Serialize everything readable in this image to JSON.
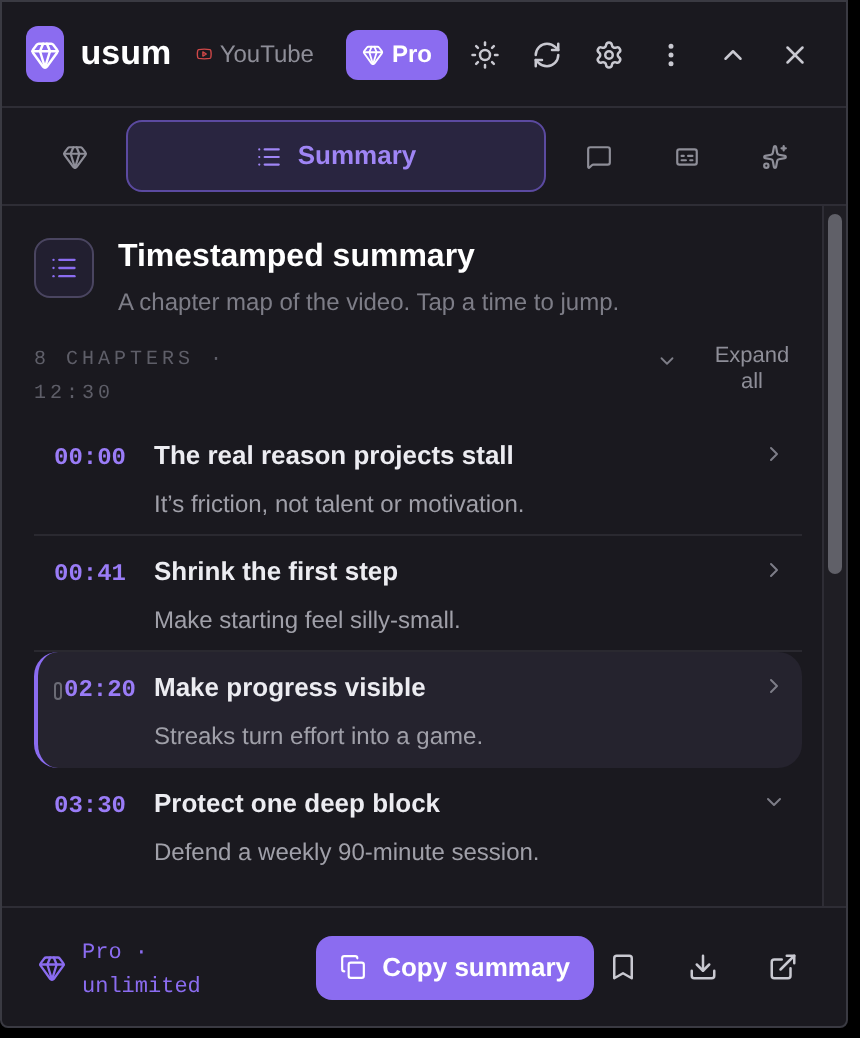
{
  "header": {
    "app_name": "usum",
    "source": "YouTube",
    "plan_button": "Pro"
  },
  "tabs": [
    {
      "kind": "icon",
      "selected": false
    },
    {
      "kind": "label",
      "label": "Summary",
      "selected": true
    },
    {
      "kind": "icon",
      "selected": false
    },
    {
      "kind": "icon",
      "selected": false
    },
    {
      "kind": "icon",
      "selected": false
    }
  ],
  "section": {
    "title": "Timestamped summary",
    "subtitle": "A chapter map of the video. Tap a time to jump.",
    "meta": "8 CHAPTERS · 12:30",
    "expand_all": "Expand all"
  },
  "chapters": [
    {
      "time": "00:00",
      "title": "The real reason projects stall",
      "summary": "It’s friction, not talent or motivation.",
      "selected": false,
      "expanded": false
    },
    {
      "time": "00:41",
      "title": "Shrink the first step",
      "summary": "Make starting feel silly-small.",
      "selected": false,
      "expanded": false
    },
    {
      "time": "02:20",
      "title": "Make progress visible",
      "summary": "Streaks turn effort into a game.",
      "selected": true,
      "expanded": false
    },
    {
      "time": "03:30",
      "title": "Protect one deep block",
      "summary": "Defend a weekly 90-minute session.",
      "selected": false,
      "expanded": true
    }
  ],
  "footer": {
    "plan": "Pro · unlimited",
    "copy_button": "Copy summary"
  }
}
